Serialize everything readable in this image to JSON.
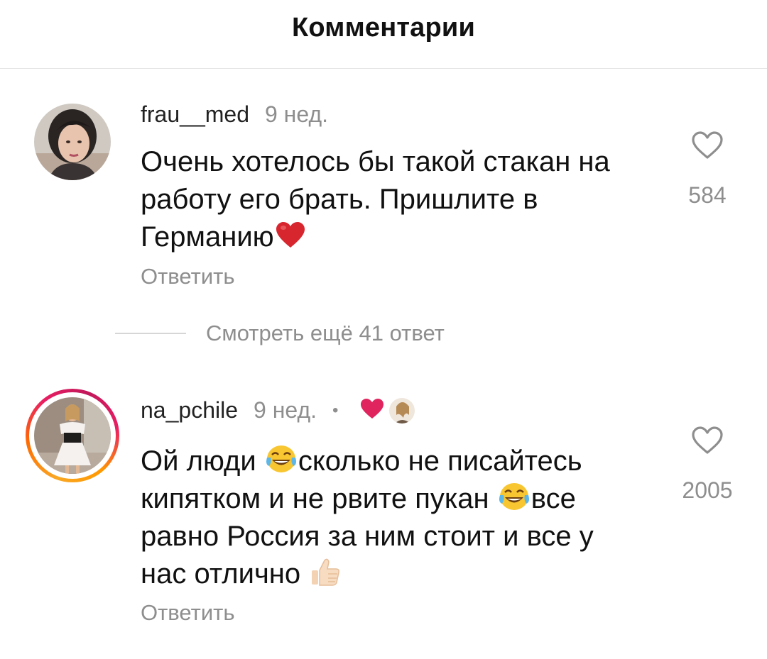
{
  "header": {
    "title": "Комментарии"
  },
  "comments": [
    {
      "username": "frau__med",
      "time": "9 нед.",
      "text_lines": [
        "Очень хотелось бы такой стакан на",
        "работу его брать. Пришлите в",
        "Германию"
      ],
      "likes": "584",
      "reply": "Ответить"
    },
    {
      "username": "na_pchile",
      "time": "9 нед.",
      "separator": "•",
      "text_lines": [
        "Ой люди ",
        "сколько не писайтесь",
        "кипятком и не рвите пукан ",
        "все",
        "равно Россия за ним стоит и все у",
        "нас отлично "
      ],
      "likes": "2005",
      "reply": "Ответить"
    }
  ],
  "view_replies": "Смотреть ещё 41 ответ",
  "icons": {
    "like": "heart-outline-icon",
    "creator_like": "red-heart-icon",
    "laugh": "face-with-tears-of-joy-icon",
    "thumbs": "thumbs-up-icon"
  },
  "colors": {
    "text": "#111111",
    "secondary": "#8e8e8e",
    "heart": "#e0245e",
    "divider": "#e4e4e4"
  }
}
